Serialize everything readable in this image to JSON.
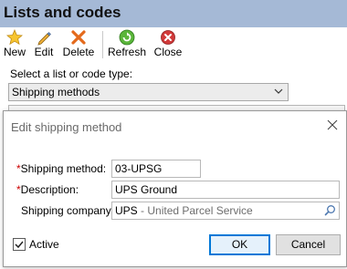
{
  "window": {
    "title": "Lists and codes"
  },
  "toolbar": {
    "new_label": "New",
    "edit_label": "Edit",
    "delete_label": "Delete",
    "refresh_label": "Refresh",
    "close_label": "Close"
  },
  "type_select": {
    "label": "Select a list or code type:",
    "value": "Shipping methods"
  },
  "dialog": {
    "title": "Edit shipping method",
    "shipping_method": {
      "label": "Shipping method:",
      "value": "03-UPSG",
      "required": "*"
    },
    "description": {
      "label": "Description:",
      "value": "UPS Ground",
      "required": "*"
    },
    "shipping_company": {
      "label": "Shipping company:",
      "code": "UPS",
      "name": " - United Parcel Service"
    },
    "active": {
      "label": "Active",
      "checked": true
    },
    "ok_label": "OK",
    "cancel_label": "Cancel"
  },
  "colors": {
    "titlebar": "#a5b9d6",
    "required": "#cc0000",
    "default_button_border": "#0078d7"
  },
  "icons": [
    "star-icon",
    "pencil-icon",
    "delete-x-icon",
    "refresh-icon",
    "close-circle-icon",
    "chevron-down-icon",
    "dialog-close-icon",
    "magnifier-icon",
    "checkmark-icon"
  ]
}
